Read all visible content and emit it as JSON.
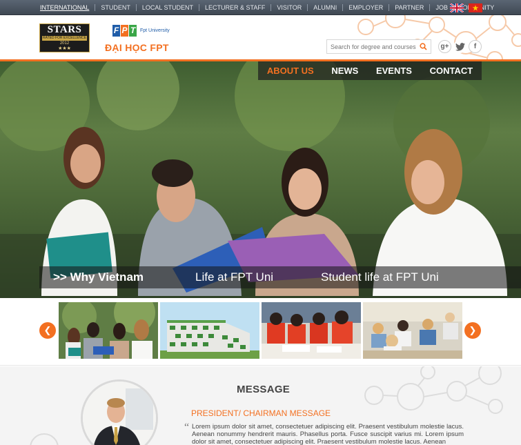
{
  "topbar": {
    "items": [
      "INTERNATIONAL",
      "STUDENT",
      "LOCAL STUDENT",
      "LECTURER & STAFF",
      "VISITOR",
      "ALUMNI",
      "EMPLOYER",
      "PARTNER",
      "JOB OPPORTUNITY"
    ],
    "active_index": 0
  },
  "logos": {
    "stars_title": "STARS",
    "stars_sub": "RATED FOR EXCELLENCE",
    "stars_year": "2012",
    "stars_rating": "★★★",
    "fpt_letters": [
      "F",
      "P",
      "T"
    ],
    "fpt_colors": [
      "#1f5ca8",
      "#f37021",
      "#3aa647"
    ],
    "fpt_sub": "Fpt University",
    "dai_hoc": "ĐẠI HỌC FPT"
  },
  "search": {
    "placeholder": "Search for degree and courses"
  },
  "social": {
    "google_plus": "g+",
    "twitter": "twitter",
    "facebook": "f"
  },
  "mainnav": {
    "items": [
      "ABOUT US",
      "NEWS",
      "EVENTS",
      "CONTACT"
    ],
    "active_index": 0
  },
  "hero": {
    "captions": [
      ">> Why Vietnam",
      "Life at FPT Uni",
      "Student life at FPT Uni"
    ]
  },
  "carousel": {
    "prev_icon": "chevron-left-icon",
    "next_icon": "chevron-right-icon",
    "thumbnails": [
      "students-outdoor",
      "campus-building",
      "students-red-shirts",
      "classroom"
    ]
  },
  "message": {
    "title": "MESSAGE",
    "subtitle": "PRESIDENT/ CHAIRMAN MESSAGE",
    "body": "Lorem ipsum dolor sit amet, consectetuer adipiscing elit. Praesent vestibulum molestie lacus. Aenean nonummy hendrerit mauris. Phasellus porta. Fusce suscipit varius mi. Lorem ipsum dolor sit amet, consectetuer adipiscing elit. Praesent vestibulum molestie lacus. Aenean"
  },
  "colors": {
    "accent": "#f37021",
    "topbar": "#4a5360",
    "text": "#444444"
  }
}
